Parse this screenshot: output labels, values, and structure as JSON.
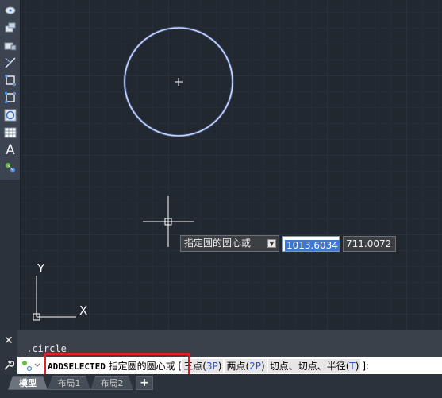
{
  "toolbar": {
    "icons": [
      "point-style-icon",
      "polyline-icon",
      "rectangle-icon",
      "line-icon",
      "region-icon",
      "boundary-icon",
      "circle-icon",
      "table-icon",
      "text-icon",
      "object-snap-icon"
    ],
    "text_glyph": "A"
  },
  "canvas": {
    "ucs": {
      "x_label": "X",
      "y_label": "Y"
    }
  },
  "dynamic_input": {
    "prompt": "指定圆的圆心或",
    "dropdown_glyph": "▼",
    "x_value": "1013.6034",
    "y_value": "711.0072"
  },
  "command": {
    "close_glyph": "✕",
    "history": "_.circle",
    "line": {
      "command_name": "ADDSELECTED",
      "prompt": " 指定圆的圆心或 ",
      "bracket_open": "[",
      "options": [
        {
          "label": "三点(",
          "key": "3P",
          "close": ")"
        },
        {
          "label": "两点(",
          "key": "2P",
          "close": ")"
        },
        {
          "label": "切点、切点、半径(",
          "key": "T",
          "close": ")"
        }
      ],
      "suffix": "]:"
    }
  },
  "tabs": {
    "items": [
      "模型",
      "布局1",
      "布局2"
    ],
    "active_index": 0,
    "add_label": "+"
  },
  "colors": {
    "canvas_bg": "#212830",
    "circle": "#b9c8ff",
    "highlight_border": "#e2202a",
    "selection": "#3d78d6"
  }
}
